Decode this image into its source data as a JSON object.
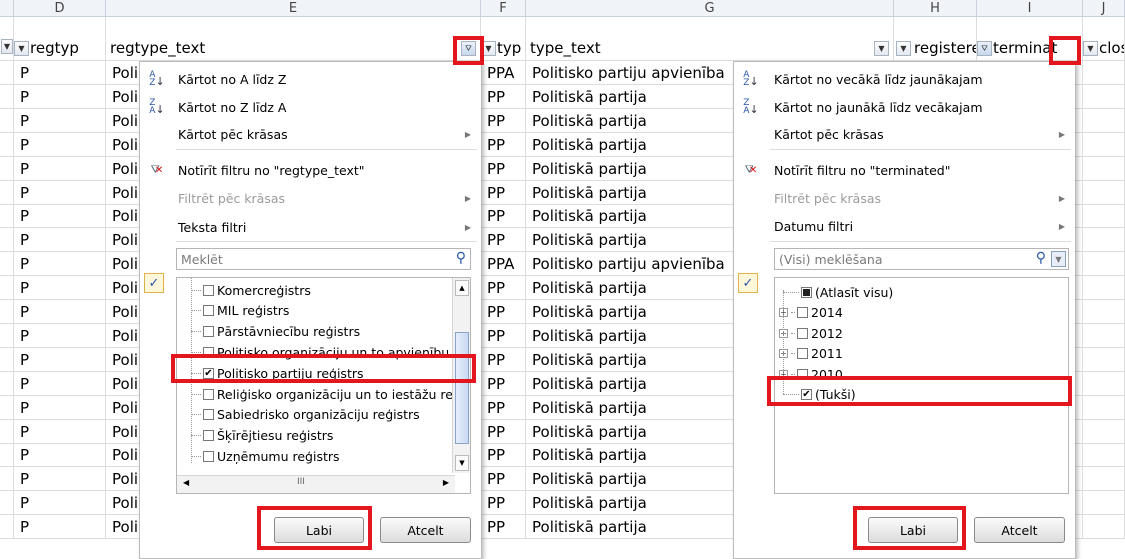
{
  "columns": {
    "letters": [
      "D",
      "E",
      "F",
      "G",
      "H",
      "I",
      "J"
    ],
    "filter_labels": {
      "D": "regtyp",
      "E": "regtype_text",
      "F": "typ",
      "G": "type_text",
      "H": "registere",
      "I": "terminat",
      "J": "close"
    }
  },
  "rows": {
    "regtype": [
      "P",
      "P",
      "P",
      "P",
      "P",
      "P",
      "P",
      "P",
      "P",
      "P",
      "P",
      "P",
      "P",
      "P",
      "P",
      "P",
      "P",
      "P",
      "P",
      "P"
    ],
    "regtype_text_prefix": [
      "Poli",
      "Poli",
      "Poli",
      "Poli",
      "Poli",
      "Poli",
      "Poli",
      "Poli",
      "Poli",
      "Poli",
      "Poli",
      "Poli",
      "Poli",
      "Poli",
      "Poli",
      "Poli",
      "Poli",
      "Poli",
      "Poli",
      "Poli"
    ],
    "type": [
      "PPA",
      "PP",
      "PP",
      "PP",
      "PP",
      "PP",
      "PP",
      "PP",
      "PPA",
      "PP",
      "PP",
      "PP",
      "PP",
      "PP",
      "PP",
      "PP",
      "PP",
      "PP",
      "PP",
      "PP"
    ],
    "type_text": [
      "Politisko partiju apvienība",
      "Politiskā partija",
      "Politiskā partija",
      "Politiskā partija",
      "Politiskā partija",
      "Politiskā partija",
      "Politiskā partija",
      "Politiskā partija",
      "Politisko partiju apvienība",
      "Politiskā partija",
      "Politiskā partija",
      "Politiskā partija",
      "Politiskā partija",
      "Politiskā partija",
      "Politiskā partija",
      "Politiskā partija",
      "Politiskā partija",
      "Politiskā partija",
      "Politiskā partija",
      "Politiskā partija"
    ]
  },
  "filter1": {
    "sort_az": "Kārtot no A līdz Z",
    "sort_za": "Kārtot no Z līdz A",
    "sort_color": "Kārtot pēc krāsas",
    "clear": "Notīrīt filtru no \"regtype_text\"",
    "filter_color": "Filtrēt pēc krāsas",
    "text_filters": "Teksta filtri",
    "search_placeholder": "Meklēt",
    "items": [
      {
        "label": "Komercreģistrs",
        "checked": false
      },
      {
        "label": "MIL reģistrs",
        "checked": false
      },
      {
        "label": "Pārstāvniecību reģistrs",
        "checked": false
      },
      {
        "label": "Politisko organizāciju un to apvienību",
        "checked": false
      },
      {
        "label": "Politisko partiju reģistrs",
        "checked": true
      },
      {
        "label": "Reliģisko organizāciju un to iestāžu re",
        "checked": false
      },
      {
        "label": "Sabiedrisko organizāciju reģistrs",
        "checked": false
      },
      {
        "label": "Šķīrējtiesu reģistrs",
        "checked": false
      },
      {
        "label": "Uzņēmumu reģistrs",
        "checked": false
      }
    ],
    "ok": "Labi",
    "cancel": "Atcelt"
  },
  "filter2": {
    "sort_old_new": "Kārtot no vecākā līdz jaunākajam",
    "sort_new_old": "Kārtot no jaunākā līdz vecākajam",
    "sort_color": "Kārtot pēc krāsas",
    "clear": "Notīrīt filtru no \"terminated\"",
    "filter_color": "Filtrēt pēc krāsas",
    "date_filters": "Datumu filtri",
    "search_placeholder": "(Visi) meklēšana",
    "items": [
      {
        "label": "(Atlasīt visu)",
        "state": "partial"
      },
      {
        "label": "2014",
        "state": "off"
      },
      {
        "label": "2012",
        "state": "off"
      },
      {
        "label": "2011",
        "state": "off"
      },
      {
        "label": "2010",
        "state": "off"
      },
      {
        "label": "(Tukši)",
        "state": "on"
      }
    ],
    "ok": "Labi",
    "cancel": "Atcelt"
  },
  "icons": {
    "sort_az": "A↓Z",
    "sort_za": "Z↓A",
    "clear_filter": "funnel-x",
    "search": "magnifier",
    "filter_active": "funnel"
  },
  "colors": {
    "highlight": "#e3161e"
  }
}
